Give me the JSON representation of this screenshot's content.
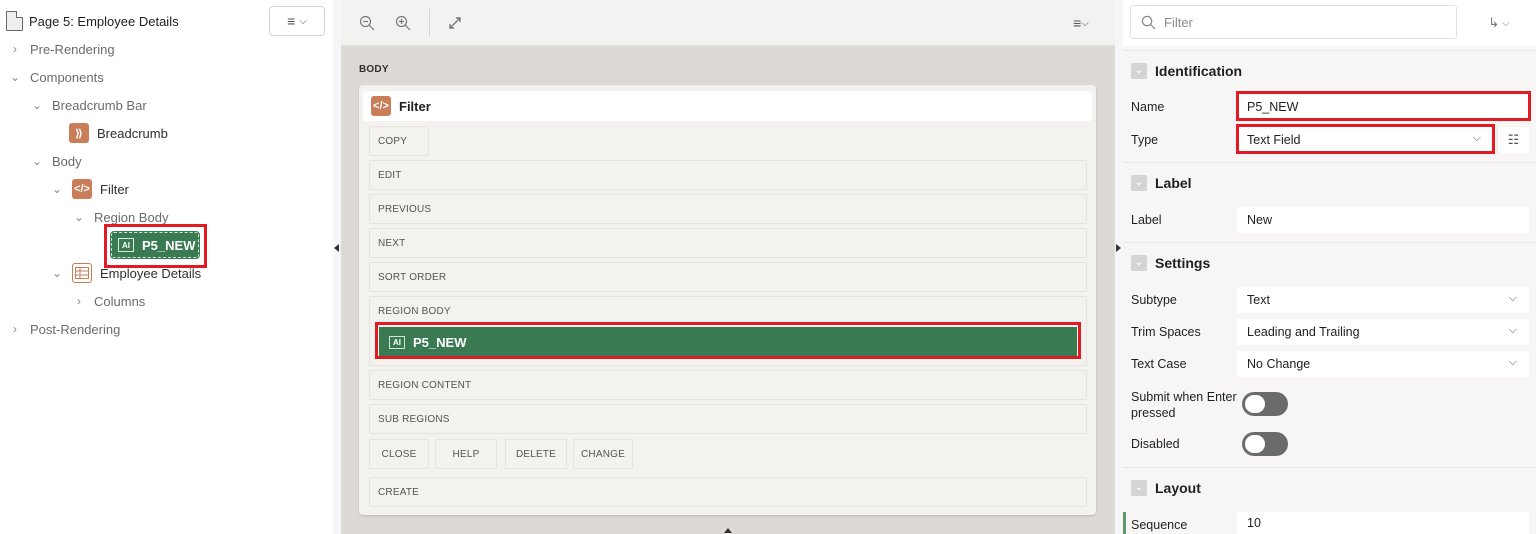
{
  "tree": {
    "page_title": "Page 5: Employee Details",
    "nodes": {
      "pre_rendering": "Pre-Rendering",
      "components": "Components",
      "breadcrumb_bar": "Breadcrumb Bar",
      "breadcrumb": "Breadcrumb",
      "body": "Body",
      "filter": "Filter",
      "region_body": "Region Body",
      "item": "P5_NEW",
      "employee_details": "Employee Details",
      "columns": "Columns",
      "post_rendering": "Post-Rendering"
    }
  },
  "layout": {
    "body_label": "BODY",
    "region_title": "Filter",
    "slots": {
      "copy": "COPY",
      "edit": "EDIT",
      "previous": "PREVIOUS",
      "next": "NEXT",
      "sort_order": "SORT ORDER",
      "region_body": "REGION BODY",
      "region_content": "REGION CONTENT",
      "sub_regions": "SUB REGIONS",
      "close": "CLOSE",
      "help": "HELP",
      "delete": "DELETE",
      "change": "CHANGE",
      "create": "CREATE"
    },
    "item": "P5_NEW"
  },
  "properties": {
    "filter_placeholder": "Filter",
    "identification": {
      "title": "Identification",
      "name_label": "Name",
      "name_value": "P5_NEW",
      "type_label": "Type",
      "type_value": "Text Field"
    },
    "label_group": {
      "title": "Label",
      "label_label": "Label",
      "label_value": "New"
    },
    "settings": {
      "title": "Settings",
      "subtype_label": "Subtype",
      "subtype_value": "Text",
      "trim_label": "Trim Spaces",
      "trim_value": "Leading and Trailing",
      "textcase_label": "Text Case",
      "textcase_value": "No Change",
      "submit_label": "Submit when Enter pressed",
      "disabled_label": "Disabled"
    },
    "layout_group": {
      "title": "Layout",
      "sequence_label": "Sequence",
      "sequence_value": "10"
    }
  },
  "colors": {
    "item_green": "#3a7a52",
    "highlight_red": "#e01b24",
    "region_orange": "#c97d58"
  }
}
